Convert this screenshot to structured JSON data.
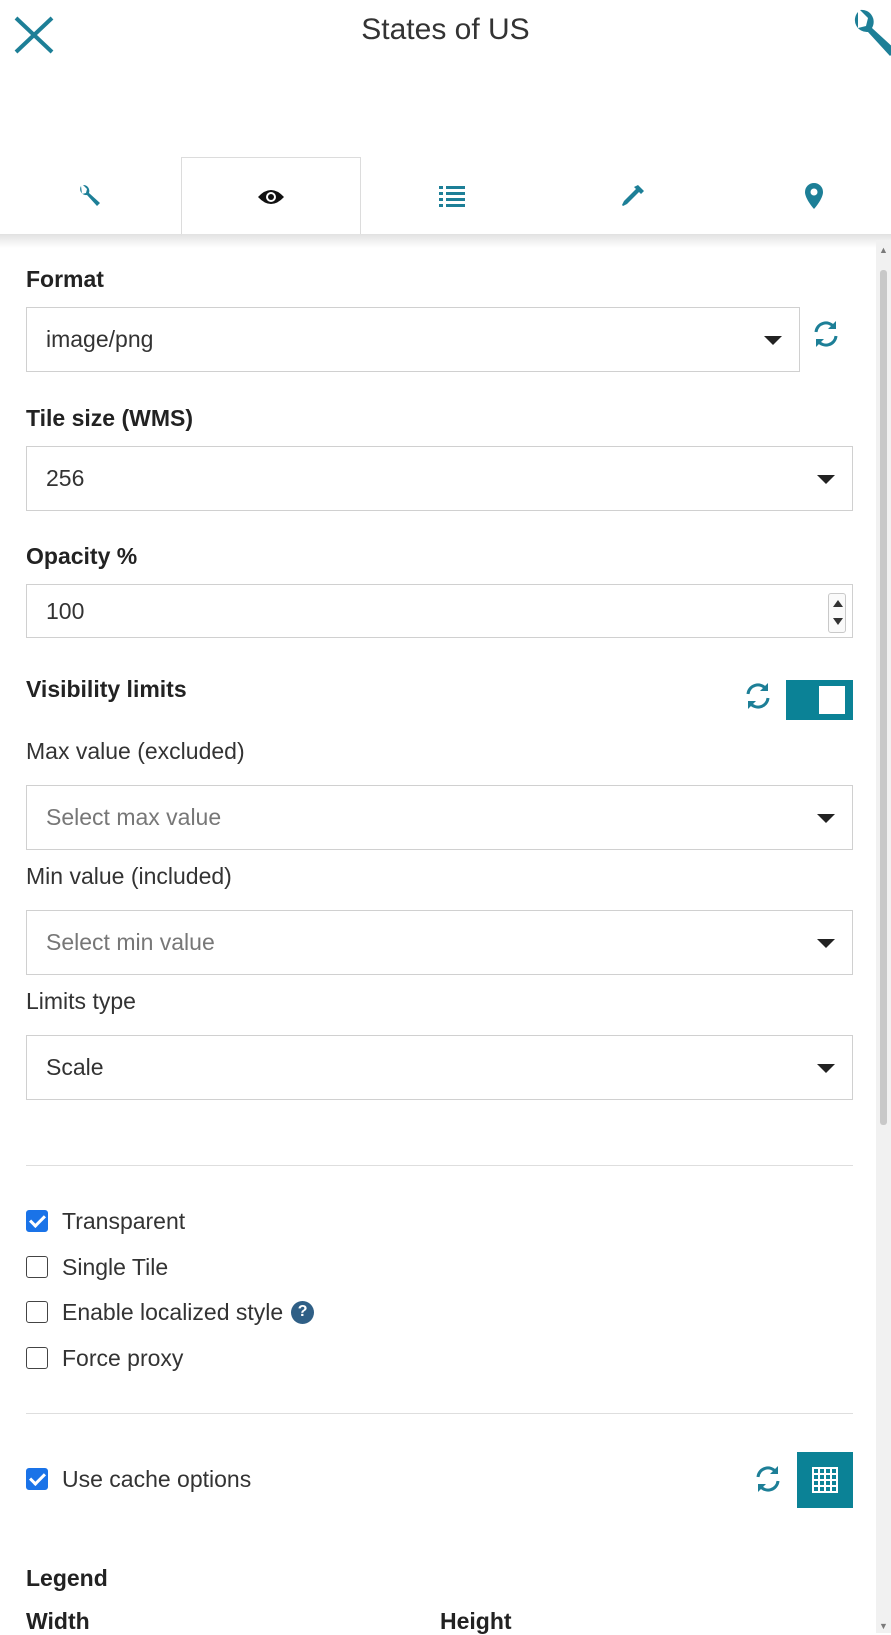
{
  "header": {
    "title": "States of US",
    "close_icon": "close-icon",
    "settings_icon": "wrench-icon"
  },
  "tabs": [
    {
      "icon": "wrench-icon",
      "active": false
    },
    {
      "icon": "eye-icon",
      "active": true
    },
    {
      "icon": "list-icon",
      "active": false
    },
    {
      "icon": "eyedropper-icon",
      "active": false
    },
    {
      "icon": "map-marker-icon",
      "active": false
    }
  ],
  "colors": {
    "accent": "#0b8296",
    "checkbox": "#1a73e8",
    "help": "#2f5f86"
  },
  "form": {
    "format": {
      "label": "Format",
      "value": "image/png"
    },
    "tile_size": {
      "label": "Tile size (WMS)",
      "value": "256"
    },
    "opacity": {
      "label": "Opacity %",
      "value": "100"
    },
    "visibility_limits": {
      "label": "Visibility limits",
      "enabled": true,
      "max_label": "Max value (excluded)",
      "max_placeholder": "Select max value",
      "min_label": "Min value (included)",
      "min_placeholder": "Select min value",
      "type_label": "Limits type",
      "type_value": "Scale"
    },
    "options": [
      {
        "label": "Transparent",
        "checked": true
      },
      {
        "label": "Single Tile",
        "checked": false
      },
      {
        "label": "Enable localized style",
        "checked": false
      },
      {
        "label": "Force proxy",
        "checked": false
      }
    ],
    "cache": {
      "label": "Use cache options",
      "checked": true
    },
    "legend": {
      "label": "Legend",
      "width_label": "Width",
      "height_label": "Height"
    }
  }
}
